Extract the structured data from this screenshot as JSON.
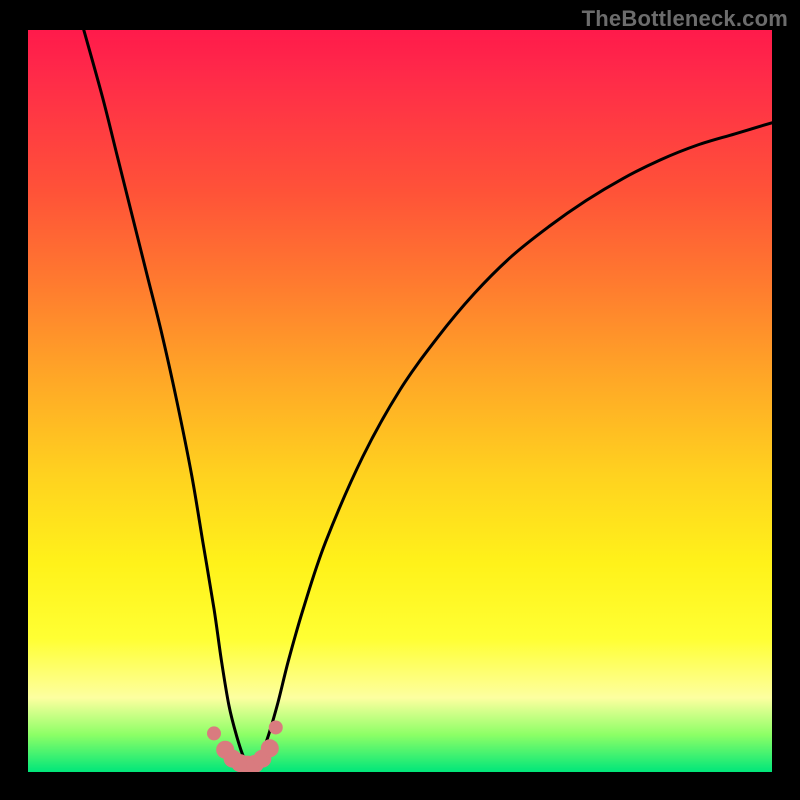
{
  "watermark": "TheBottleneck.com",
  "colors": {
    "page_bg": "#000000",
    "curve_stroke": "#000000",
    "marker_fill": "#d97b7f",
    "gradient_top": "#ff1a4b",
    "gradient_bottom": "#00e67a"
  },
  "chart_data": {
    "type": "line",
    "title": "",
    "xlabel": "",
    "ylabel": "",
    "xlim": [
      0,
      100
    ],
    "ylim": [
      0,
      100
    ],
    "series": [
      {
        "name": "bottleneck-curve",
        "x": [
          7.5,
          10,
          12,
          14,
          16,
          18,
          20,
          22,
          23.5,
          25,
          26,
          27,
          28,
          29,
          30,
          31,
          32,
          33.5,
          35,
          37,
          40,
          45,
          50,
          55,
          60,
          65,
          70,
          75,
          80,
          85,
          90,
          95,
          100
        ],
        "values": [
          100,
          91,
          83,
          75,
          67,
          59,
          50,
          40,
          31,
          22,
          15,
          9,
          5,
          2,
          1,
          2,
          4,
          9,
          15,
          22,
          31,
          42.5,
          51.5,
          58.5,
          64.5,
          69.5,
          73.5,
          77,
          80,
          82.5,
          84.5,
          86,
          87.5
        ]
      }
    ],
    "markers": {
      "name": "red-dots",
      "x": [
        25,
        26.5,
        27.5,
        28.5,
        29.5,
        30.5,
        31.5,
        32.5,
        33.3
      ],
      "values": [
        5.2,
        3.0,
        1.8,
        1.2,
        1.0,
        1.1,
        1.8,
        3.2,
        6.0
      ]
    }
  }
}
